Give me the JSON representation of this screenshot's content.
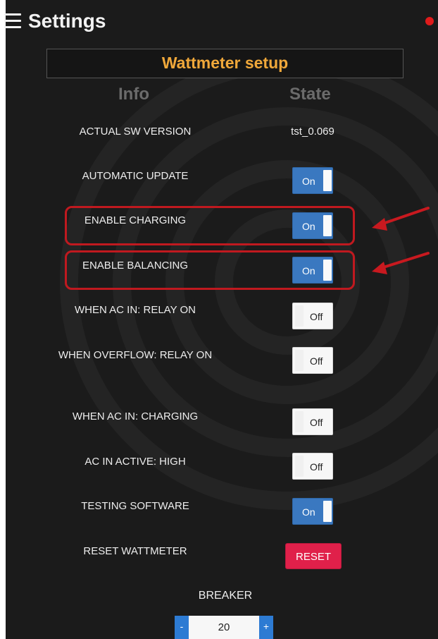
{
  "header": {
    "title": "Settings",
    "menu_icon": "hamburger-menu-icon",
    "status_dot_color": "#e01b1b"
  },
  "panel": {
    "title": "Wattmeter setup",
    "title_color": "#f0a83a",
    "col_info": "Info",
    "col_state": "State"
  },
  "rows": {
    "sw_version": {
      "label": "ACTUAL SW VERSION",
      "value": "tst_0.069"
    },
    "auto_update": {
      "label": "AUTOMATIC UPDATE",
      "state": "On"
    },
    "enable_charging": {
      "label": "ENABLE CHARGING",
      "state": "On"
    },
    "enable_balancing": {
      "label": "ENABLE BALANCING",
      "state": "On"
    },
    "ac_in_relay": {
      "label": "WHEN AC IN: RELAY ON",
      "state": "Off"
    },
    "overflow_relay": {
      "label": "WHEN OVERFLOW: RELAY ON",
      "state": "Off"
    },
    "ac_in_charging": {
      "label": "WHEN AC IN: CHARGING",
      "state": "Off"
    },
    "ac_in_active_high": {
      "label": "AC IN ACTIVE: HIGH",
      "state": "Off"
    },
    "testing_software": {
      "label": "TESTING SOFTWARE",
      "state": "On"
    },
    "reset_wattmeter": {
      "label": "RESET WATTMETER",
      "button": "RESET"
    }
  },
  "breaker": {
    "label": "BREAKER",
    "value": "20",
    "minus": "-",
    "plus": "+"
  },
  "colors": {
    "toggle_on": "#3a78c0",
    "toggle_off": "#f7f7f7",
    "reset_button": "#e0204a",
    "annotation_red": "#c0191f",
    "background": "#1b1b1b"
  }
}
